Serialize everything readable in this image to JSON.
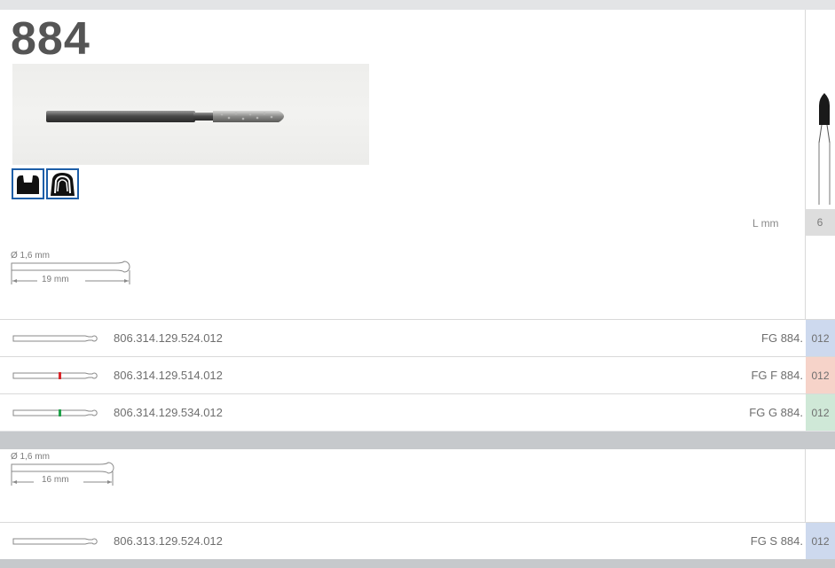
{
  "header": {
    "model_number": "884"
  },
  "product": {
    "icons": [
      "tooth-crown-preparation-icon",
      "tooth-crown-outline-icon"
    ],
    "length_label": "L mm",
    "length_value": "6"
  },
  "shank_dimensions_1": {
    "diameter": "Ø 1,6 mm",
    "length": "19 mm"
  },
  "rows_1": [
    {
      "code": "806.314.129.524.012",
      "fg": "FG 884.",
      "size": "012",
      "stripe": "none",
      "size_bg": "#cdd9ee"
    },
    {
      "code": "806.314.129.514.012",
      "fg": "FG F 884.",
      "size": "012",
      "stripe": "#d9262a",
      "size_bg": "#f6d3c9"
    },
    {
      "code": "806.314.129.534.012",
      "fg": "FG G 884.",
      "size": "012",
      "stripe": "#21a24a",
      "size_bg": "#cfe8d7"
    }
  ],
  "shank_dimensions_2": {
    "diameter": "Ø 1,6 mm",
    "length": "16 mm"
  },
  "rows_2": [
    {
      "code": "806.313.129.524.012",
      "fg": "FG S 884.",
      "size": "012",
      "stripe": "none",
      "size_bg": "#cdd9ee"
    }
  ]
}
